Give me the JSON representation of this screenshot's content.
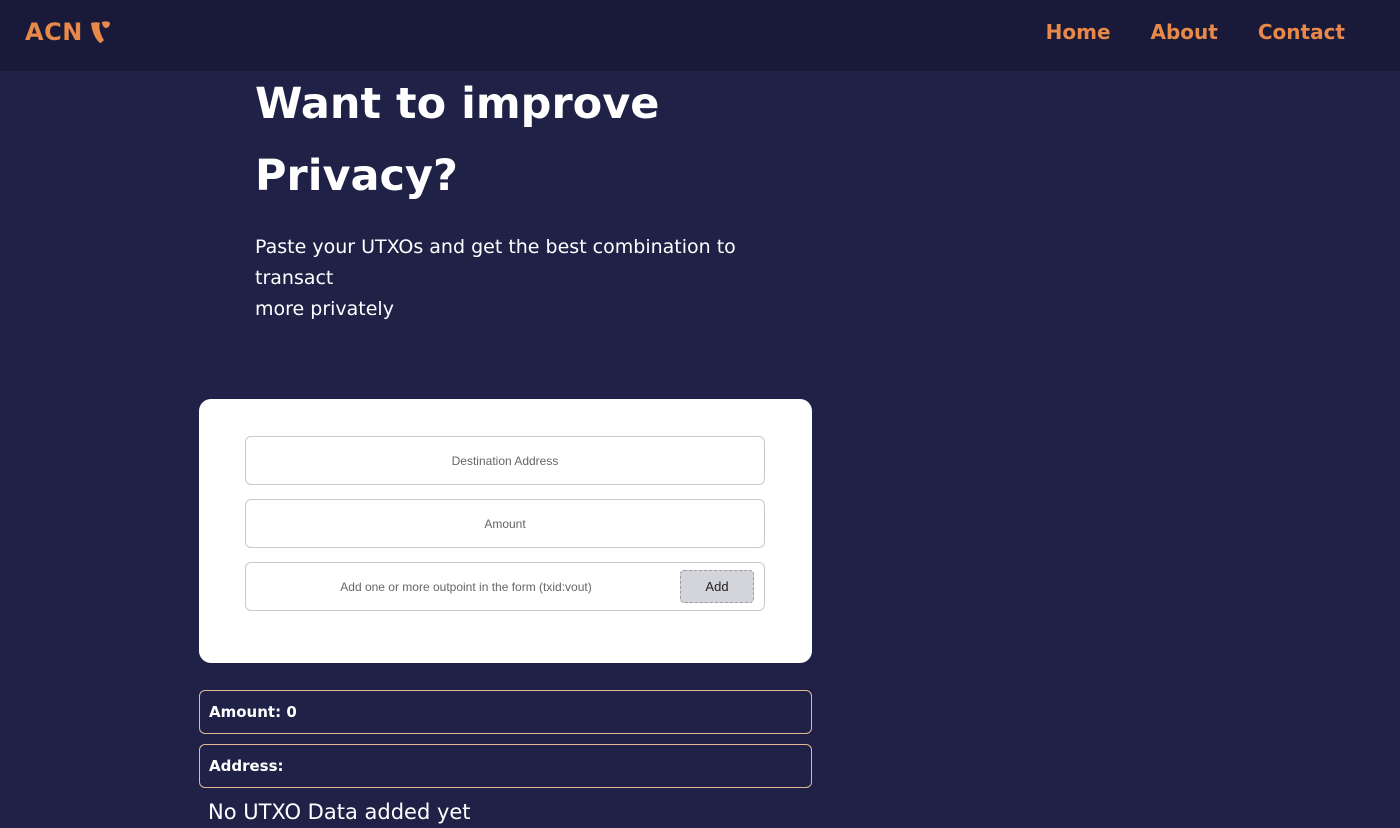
{
  "nav": {
    "logo_text": "ACN",
    "links": [
      "Home",
      "About",
      "Contact"
    ]
  },
  "hero": {
    "title_line1": "Want to improve",
    "title_line2": "Privacy?",
    "subtitle_line1": "Paste your UTXOs and get the best combination to",
    "subtitle_line2": "transact",
    "subtitle_line3": "more privately"
  },
  "form": {
    "destination_placeholder": "Destination Address",
    "amount_placeholder": "Amount",
    "outpoint_placeholder": "Add one or more outpoint in the form (txid:vout)",
    "add_label": "Add"
  },
  "summary": {
    "amount_label": "Amount:",
    "amount_value": "0",
    "address_label": "Address:",
    "address_value": ""
  },
  "empty_message": "No UTXO Data added yet",
  "colors": {
    "background": "#1f2147",
    "navbar": "#191a3a",
    "accent": "#e8894a"
  },
  "icons": {
    "logo": "typo3-logo-icon"
  }
}
